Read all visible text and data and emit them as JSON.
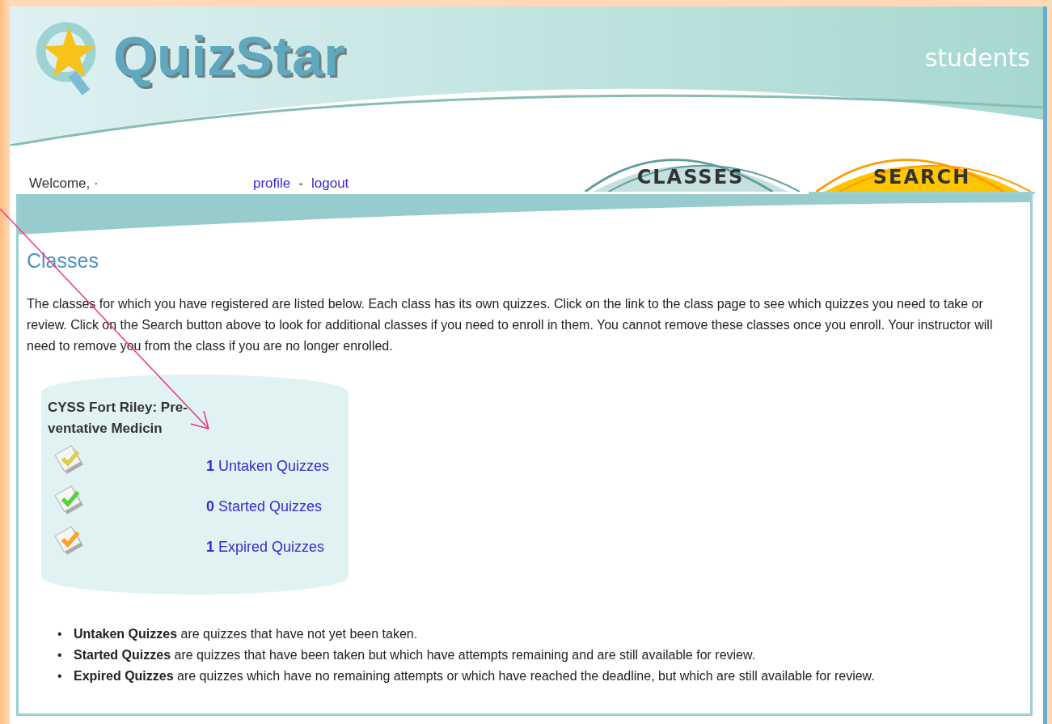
{
  "header": {
    "logo_text": "QuizStar",
    "area": "students"
  },
  "user_bar": {
    "welcome": "Welcome, ·",
    "links": [
      "profile",
      "logout"
    ],
    "separator": "-"
  },
  "tabs": [
    {
      "label": "CLASSES",
      "selected": true,
      "color": "#c6e0e0"
    },
    {
      "label": "SEARCH",
      "selected": false,
      "color": "#ffc600"
    }
  ],
  "content": {
    "title": "Classes",
    "intro": "The classes for which you have registered are listed below. Each class has its own quizzes. Click on the link to the class page to see which quizzes you need to take or review. Click on the Search button above to look for additional classes if you need to enroll in them. You cannot remove these classes once you enroll. Your instructor will need to remove you from the class if you are no longer enrolled.",
    "class_card": {
      "title": "CYSS Fort Riley: Pre-ventative Medicin",
      "quizzes": [
        {
          "kind": "untaken",
          "count": "1",
          "label": "Untaken Quizzes"
        },
        {
          "kind": "started",
          "count": "0",
          "label": "Started Quizzes"
        },
        {
          "kind": "expired",
          "count": "1",
          "label": "Expired Quizzes"
        }
      ]
    },
    "legend": [
      {
        "marker": "•",
        "text": "**Untaken Quizzes** are quizzes that have not yet been taken."
      },
      {
        "marker": "•",
        "text": "**Started Quizzes** are quizzes that have been taken but which have attempts remaining and are still available for review."
      },
      {
        "marker": "•",
        "text": "**Expired Quizzes** are quizzes which have no remaining attempts or which have reached the deadline, but which are still available for review."
      }
    ]
  }
}
